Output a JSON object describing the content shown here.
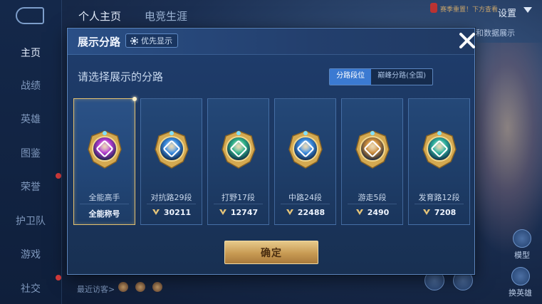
{
  "background": {
    "top_tabs": [
      "个人主页",
      "电竞生涯"
    ],
    "settings_label": "设置",
    "notice_text": "赛季重置！下方查看",
    "chip_text": "和数据展示",
    "rail_items": [
      "主页",
      "战绩",
      "英雄",
      "图鉴",
      "荣誉",
      "护卫队",
      "游戏",
      "社交"
    ],
    "recent_label": "最近访客>",
    "side_buttons": [
      "模型",
      "换英雄"
    ]
  },
  "modal": {
    "title": "展示分路",
    "priority_label": "优先显示",
    "prompt": "请选择展示的分路",
    "segment_tabs": [
      "分路段位",
      "巅峰分路(全国)"
    ],
    "active_segment": "分路段位",
    "cards": [
      {
        "name": "全能高手",
        "foot": "全能称号",
        "show_points_icon": false,
        "selected": true,
        "icon": "all-round-badge-icon",
        "color": "#b23ad0"
      },
      {
        "name": "对抗路29段",
        "foot": "30211",
        "show_points_icon": true,
        "selected": false,
        "icon": "clash-lane-badge-icon",
        "color": "#3a8be0"
      },
      {
        "name": "打野17段",
        "foot": "12747",
        "show_points_icon": true,
        "selected": false,
        "icon": "jungle-badge-icon",
        "color": "#2fb38a"
      },
      {
        "name": "中路24段",
        "foot": "22488",
        "show_points_icon": true,
        "selected": false,
        "icon": "mid-lane-badge-icon",
        "color": "#3a8be0"
      },
      {
        "name": "游走5段",
        "foot": "2490",
        "show_points_icon": true,
        "selected": false,
        "icon": "roam-badge-icon",
        "color": "#c98a3a"
      },
      {
        "name": "发育路12段",
        "foot": "7208",
        "show_points_icon": true,
        "selected": false,
        "icon": "farm-lane-badge-icon",
        "color": "#2fb3a0"
      }
    ],
    "confirm_label": "确定"
  }
}
